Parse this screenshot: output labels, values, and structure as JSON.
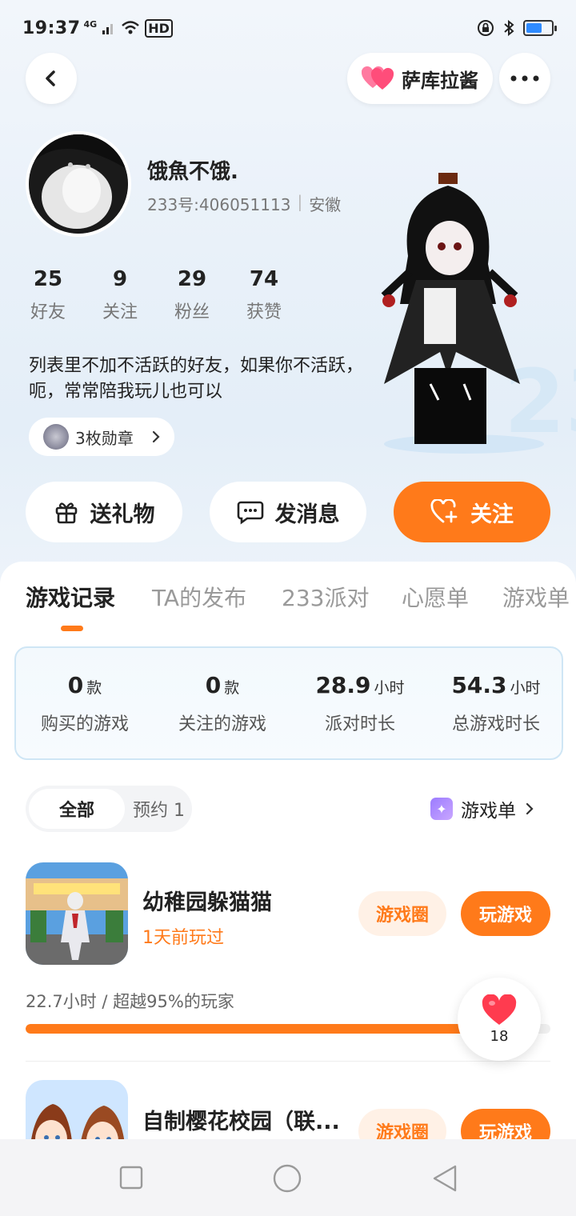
{
  "status_bar": {
    "time": "19:37",
    "network": "4G",
    "hd": "HD"
  },
  "header": {
    "friend_name": "萨库拉酱"
  },
  "profile": {
    "username": "饿魚不饿.",
    "user_id": "233号:406051113",
    "location": "安徽",
    "stats": [
      {
        "value": "25",
        "label": "好友"
      },
      {
        "value": "9",
        "label": "关注"
      },
      {
        "value": "29",
        "label": "粉丝"
      },
      {
        "value": "74",
        "label": "获赞"
      }
    ],
    "bio": "列表里不加不活跃的好友，如果你不活跃，呃，常常陪我玩儿也可以",
    "badges": "3枚勋章"
  },
  "actions": {
    "gift": "送礼物",
    "message": "发消息",
    "follow": "关注"
  },
  "tabs": [
    "游戏记录",
    "TA的发布",
    "233派对",
    "心愿单",
    "游戏单"
  ],
  "summary": [
    {
      "value": "0",
      "unit": "款",
      "label": "购买的游戏"
    },
    {
      "value": "0",
      "unit": "款",
      "label": "关注的游戏"
    },
    {
      "value": "28.9",
      "unit": "小时",
      "label": "派对时长"
    },
    {
      "value": "54.3",
      "unit": "小时",
      "label": "总游戏时长"
    }
  ],
  "filters": {
    "all": "全部",
    "reserved": "预约 1",
    "gamelist": "游戏单"
  },
  "games": [
    {
      "title": "幼稚园躲猫猫",
      "subtitle": "1天前玩过",
      "circle": "游戏圈",
      "play": "玩游戏",
      "stats": "22.7小时 / 超越95%的玩家",
      "progress": 0.95,
      "likes": "18"
    },
    {
      "title": "自制樱花校园（联...",
      "circle": "游戏圈",
      "play": "玩游戏"
    }
  ],
  "colors": {
    "accent": "#ff7a1a",
    "accent_light": "#fff1e6",
    "summary_border": "#cfe6f5"
  }
}
